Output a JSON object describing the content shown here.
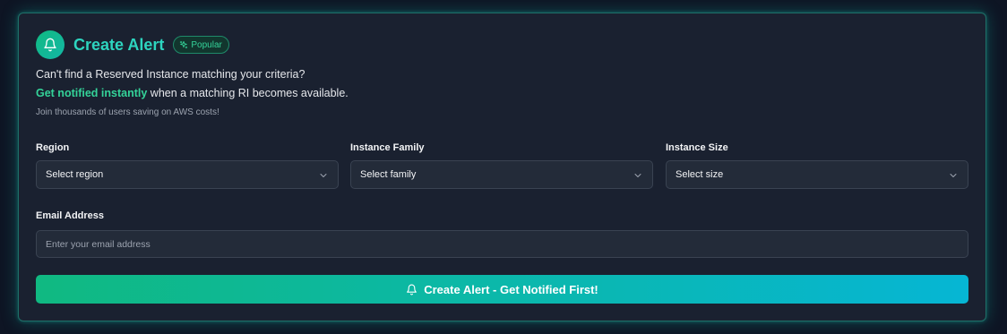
{
  "header": {
    "title": "Create Alert",
    "badge": "Popular"
  },
  "description": {
    "line1": "Can't find a Reserved Instance matching your criteria?",
    "line2_highlight": "Get notified instantly",
    "line2_rest": " when a matching RI becomes available.",
    "line3": "Join thousands of users saving on AWS costs!"
  },
  "form": {
    "region": {
      "label": "Region",
      "value": "Select region"
    },
    "family": {
      "label": "Instance Family",
      "value": "Select family"
    },
    "size": {
      "label": "Instance Size",
      "value": "Select size"
    },
    "email": {
      "label": "Email Address",
      "placeholder": "Enter your email address"
    }
  },
  "cta": {
    "label": "Create Alert - Get Notified First!"
  },
  "colors": {
    "accent": "#2dd4bf",
    "highlight": "#34d399",
    "cta_start": "#10b981",
    "cta_end": "#06b6d4"
  },
  "icons": {
    "header": "bell-icon",
    "badge": "sparkles-icon",
    "select": "chevron-down-icon",
    "cta": "bell-icon"
  }
}
